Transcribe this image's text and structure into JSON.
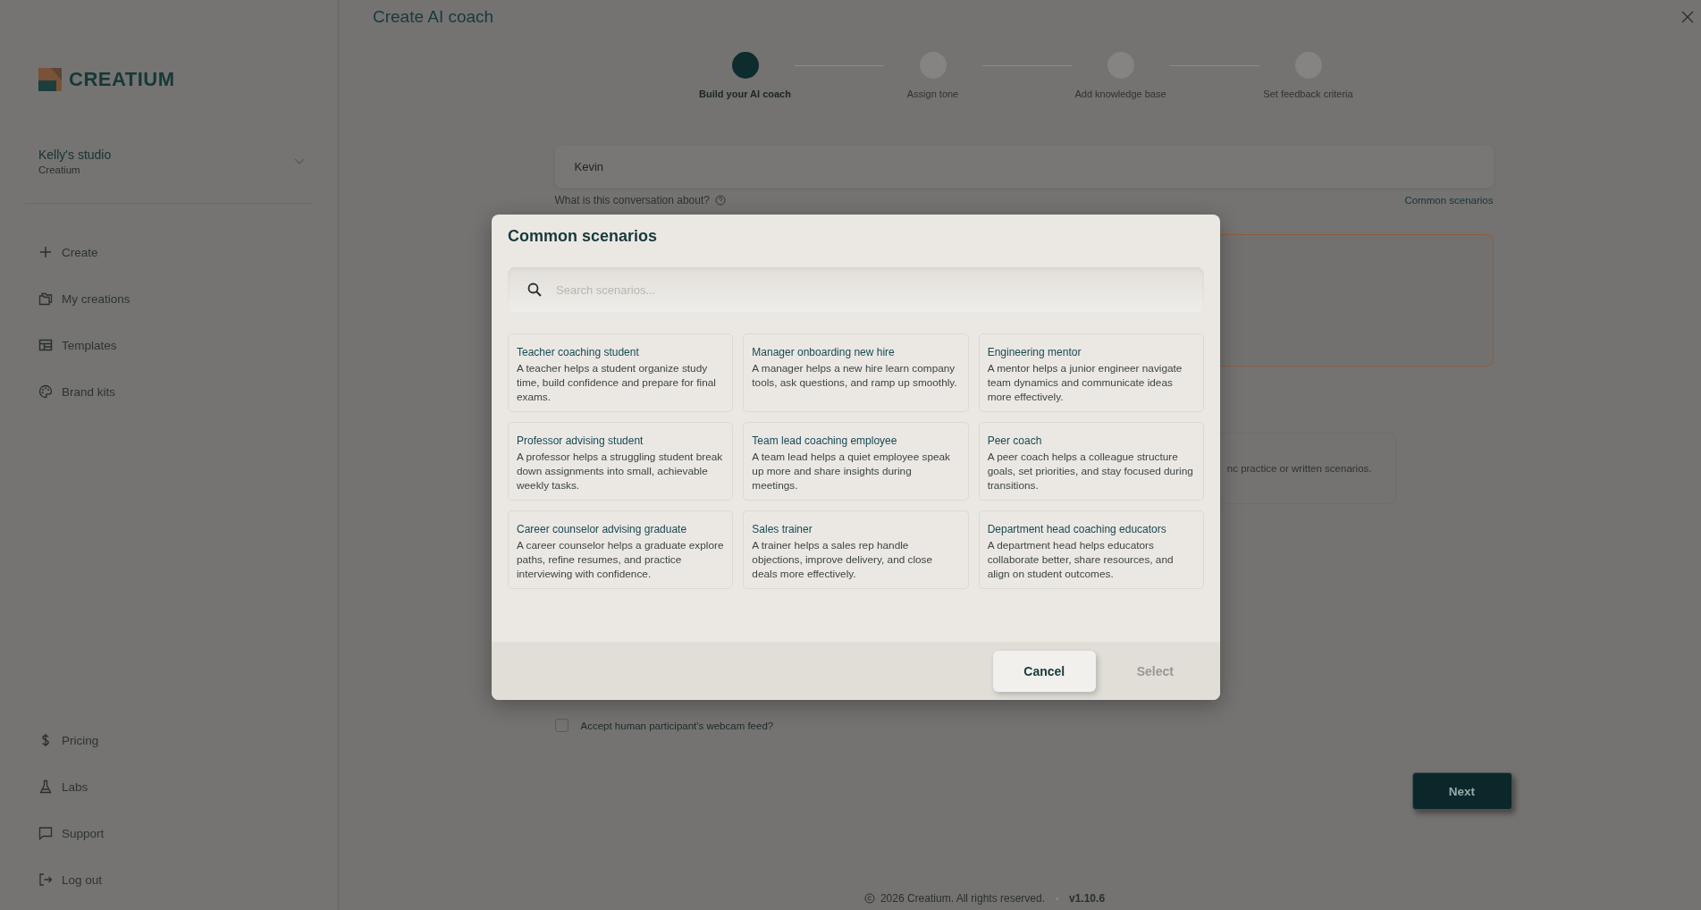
{
  "sidebar": {
    "logo": {
      "text": "CREATIUM"
    },
    "workspace": {
      "name": "Kelly's studio",
      "org": "Creatium"
    },
    "nav_items": [
      {
        "label": "Create"
      },
      {
        "label": "My creations"
      },
      {
        "label": "Templates"
      },
      {
        "label": "Brand kits"
      }
    ],
    "bottom_items": [
      {
        "label": "Pricing"
      },
      {
        "label": "Labs"
      },
      {
        "label": "Support"
      },
      {
        "label": "Log out"
      }
    ]
  },
  "page": {
    "title": "Create AI coach",
    "steps": [
      {
        "label": "Build your AI coach",
        "selected": true
      },
      {
        "label": "Assign tone",
        "selected": false
      },
      {
        "label": "Add knowledge base",
        "selected": false
      },
      {
        "label": "Set feedback criteria",
        "selected": false
      }
    ],
    "name_field": {
      "value": "Kevin"
    },
    "conversation_label": "What is this conversation about?",
    "scenarios_link": "Common scenarios",
    "mode_card_text": "nc practice or written scenarios.",
    "webcam": {
      "label": "Accept human participant's webcam feed?",
      "checked": false
    },
    "next_button": "Next",
    "footer": {
      "copyright": "2026 Creatium. All rights reserved.",
      "version": "v1.10.6"
    }
  },
  "modal": {
    "title": "Common scenarios",
    "search": {
      "placeholder": "Search scenarios..."
    },
    "scenarios": [
      {
        "title": "Teacher coaching student",
        "description": "A teacher helps a student organize study time, build confidence and prepare for final exams.",
        "selected": false
      },
      {
        "title": "Manager onboarding new hire",
        "description": "A manager helps a new hire learn company tools, ask questions, and ramp up smoothly.",
        "selected": false
      },
      {
        "title": "Engineering mentor",
        "description": "A mentor helps a junior engineer navigate team dynamics and communicate ideas more effectively.",
        "selected": false
      },
      {
        "title": "Professor advising student",
        "description": "A professor helps a struggling student break down assignments into small, achievable weekly tasks.",
        "selected": false
      },
      {
        "title": "Team lead coaching employee",
        "description": "A team lead helps a quiet employee speak up more and share insights during meetings.",
        "selected": false
      },
      {
        "title": "Peer coach",
        "description": "A peer coach helps a colleague structure goals, set priorities, and stay focused during transitions.",
        "selected": false
      },
      {
        "title": "Career counselor advising graduate",
        "description": "A career counselor helps a graduate explore paths, refine resumes, and practice interviewing with confidence.",
        "selected": false
      },
      {
        "title": "Sales trainer",
        "description": "A trainer helps a sales rep handle objections, improve delivery, and close deals more effectively.",
        "selected": false
      },
      {
        "title": "Department head coaching educators",
        "description": "A department head helps educators collaborate better, share resources, and align on student outcomes.",
        "selected": false
      }
    ],
    "cancel_button": "Cancel",
    "select_button": {
      "label": "Select",
      "disabled": true
    }
  }
}
